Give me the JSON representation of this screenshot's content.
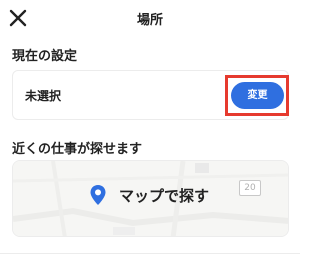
{
  "header": {
    "title": "場所",
    "close_icon": "close-icon"
  },
  "current_setting": {
    "section_title": "現在の設定",
    "value": "未選択",
    "change_label": "変更"
  },
  "nearby": {
    "section_title": "近くの仕事が探せます",
    "map_button_label": "マップで探す",
    "road_sign_number": "20"
  },
  "colors": {
    "accent": "#2f6fe0",
    "highlight": "#e63a2e",
    "pin": "#2f6fe0"
  }
}
